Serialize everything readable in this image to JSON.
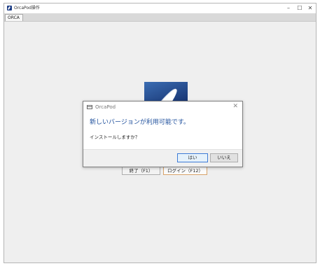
{
  "window": {
    "title": "OrcaPod操作",
    "controls": {
      "minimize": "–",
      "maximize": "☐",
      "close": "✕"
    }
  },
  "tabs": [
    {
      "label": "ORCA"
    }
  ],
  "main": {
    "exit_button": "終了（F1）",
    "login_button": "ログイン（F12）"
  },
  "dialog": {
    "title": "OrcaPod",
    "close": "✕",
    "message": "新しいバージョンが利用可能です。",
    "question": "インストールしますか？",
    "yes_button": "はい",
    "no_button": "いいえ"
  },
  "colors": {
    "accent": "#1e4f9c",
    "logo_blue": "#1d3d7c",
    "default_button_border": "#3d7bd6"
  }
}
